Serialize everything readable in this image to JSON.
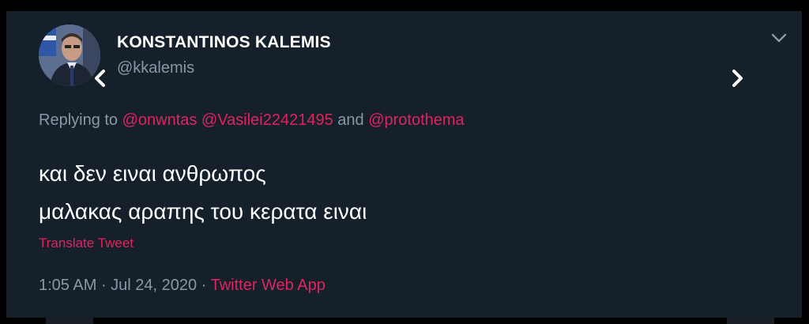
{
  "tweet": {
    "author_name": "KONSTANTINOS KALEMIS",
    "author_handle": "@kkalemis",
    "replying_prefix": "Replying to ",
    "mentions": [
      "@onwntas",
      "@Vasilei22421495",
      "@protothema"
    ],
    "mention_separator": " ",
    "mention_and": " and ",
    "text_lines": [
      "και δεν ειναι ανθρωπος",
      "μαλακας αραπης του κερατα ειναι"
    ],
    "translate_label": "Translate Tweet",
    "time": "1:05 AM",
    "separator": " · ",
    "date": "Jul 24, 2020",
    "source": "Twitter Web App"
  },
  "icons": {
    "menu": "chevron-down-icon",
    "prev": "chevron-left-icon",
    "next": "chevron-right-icon"
  },
  "colors": {
    "background": "#15202b",
    "accent": "#e0245e",
    "secondary_text": "#8899a6",
    "primary_text": "#ffffff"
  }
}
